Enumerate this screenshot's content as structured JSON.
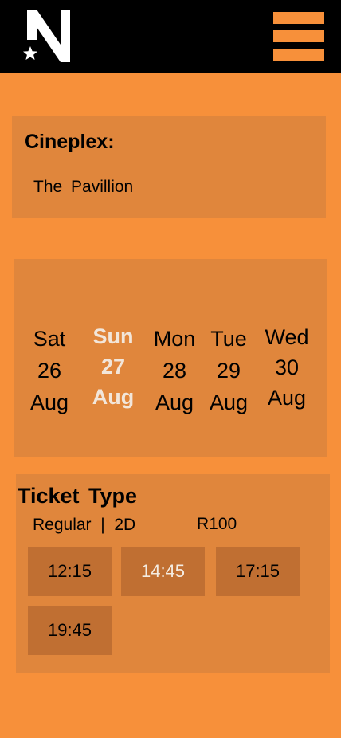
{
  "header": {
    "logo_letter": "N",
    "logo_icon": "star-icon",
    "menu_icon": "hamburger-menu-icon"
  },
  "cinema": {
    "label": "Cineplex:",
    "name": "The Pavillion"
  },
  "dates": [
    {
      "day": "Sat",
      "date": "26",
      "month": "Aug",
      "selected": false
    },
    {
      "day": "Sun",
      "date": "27",
      "month": "Aug",
      "selected": true
    },
    {
      "day": "Mon",
      "date": "28",
      "month": "Aug",
      "selected": false
    },
    {
      "day": "Tue",
      "date": "29",
      "month": "Aug",
      "selected": false
    },
    {
      "day": "Wed",
      "date": "30",
      "month": "Aug",
      "selected": false
    }
  ],
  "ticket": {
    "title": "Ticket Type",
    "info": "Regular  |  2D",
    "price": "R100",
    "times": [
      "12:15",
      "14:45",
      "17:15",
      "19:45"
    ],
    "selected_time": "14:45"
  },
  "colors": {
    "background": "#F7903A",
    "panel": "#E0863C",
    "time_button": "#C06F32",
    "header": "#000000",
    "selected_text": "#F2E6DA"
  }
}
